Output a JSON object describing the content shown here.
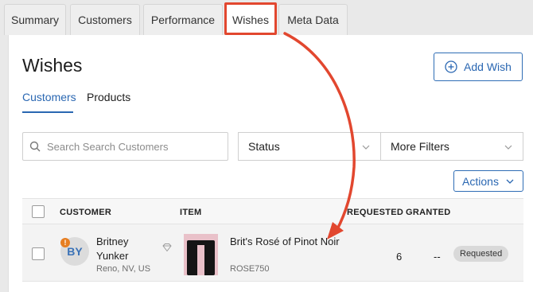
{
  "tabs": [
    {
      "label": "Summary"
    },
    {
      "label": "Customers"
    },
    {
      "label": "Performance"
    },
    {
      "label": "Wishes"
    },
    {
      "label": "Meta Data"
    }
  ],
  "page": {
    "title": "Wishes",
    "add_button": "Add Wish"
  },
  "subtabs": [
    {
      "label": "Customers"
    },
    {
      "label": "Products"
    }
  ],
  "filters": {
    "search_placeholder": "Search Search Customers",
    "status_label": "Status",
    "more_filters_label": "More Filters",
    "actions_label": "Actions"
  },
  "table": {
    "columns": [
      "CUSTOMER",
      "ITEM",
      "REQUESTED",
      "GRANTED"
    ],
    "rows": [
      {
        "initials": "BY",
        "alert_mark": "!",
        "customer_name": "Britney Yunker",
        "location": "Reno, NV, US",
        "item_name": "Brit's Rosé of Pinot Noir",
        "sku": "ROSE750",
        "requested": "6",
        "granted": "--",
        "status": "Requested"
      }
    ]
  },
  "colors": {
    "accent": "#2a67b2",
    "callout": "#e2472f",
    "alert": "#e67e22"
  }
}
